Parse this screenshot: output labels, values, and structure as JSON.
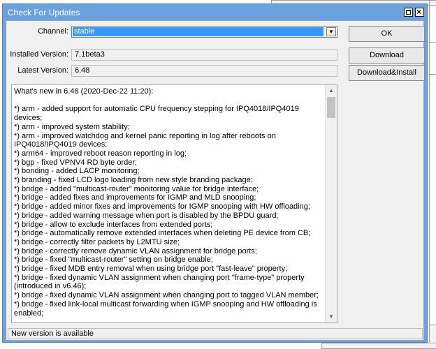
{
  "window": {
    "title": "Check For Updates"
  },
  "form": {
    "channel_label": "Channel:",
    "channel_value": "stable",
    "installed_label": "Installed Version:",
    "installed_value": "7.1beta3",
    "latest_label": "Latest Version:",
    "latest_value": "6.48"
  },
  "buttons": {
    "ok": "OK",
    "download": "Download",
    "download_install": "Download&Install"
  },
  "changelog": {
    "text": "What's new in 6.48 (2020-Dec-22 11:20):\n\n*) arm - added support for automatic CPU frequency stepping for IPQ4018/IPQ4019 devices;\n*) arm - improved system stability;\n*) arm - improved watchdog and kernel panic reporting in log after reboots on IPQ4018/IPQ4019 devices;\n*) arm64 - improved reboot reason reporting in log;\n*) bgp - fixed VPNV4 RD byte order;\n*) bonding - added LACP monitoring;\n*) branding - fixed LCD logo loading from new style branding package;\n*) bridge - added \"multicast-router\" monitoring value for bridge interface;\n*) bridge - added fixes and improvements for IGMP and MLD snooping;\n*) bridge - added minor fixes and improvements for IGMP snooping with HW offloading;\n*) bridge - added warning message when port is disabled by the BPDU guard;\n*) bridge - allow to exclude interfaces from extended ports;\n*) bridge - automatically remove extended interfaces when deleting PE device from CB;\n*) bridge - correctly filter packets by L2MTU size;\n*) bridge - correctly remove dynamic VLAN assignment for bridge ports;\n*) bridge - fixed \"multicast-router\" setting on bridge enable;\n*) bridge - fixed MDB entry removal when using bridge port \"fast-leave\" property;\n*) bridge - fixed dynamic VLAN assignment when changing port \"frame-type\" property (introduced in v6.46);\n*) bridge - fixed dynamic VLAN assignment when changing port to tagged VLAN member;\n*) bridge - fixed link-local multicast forwarding when IGMP snooping and HW offloading is enabled;"
  },
  "status": {
    "text": "New version is available"
  }
}
